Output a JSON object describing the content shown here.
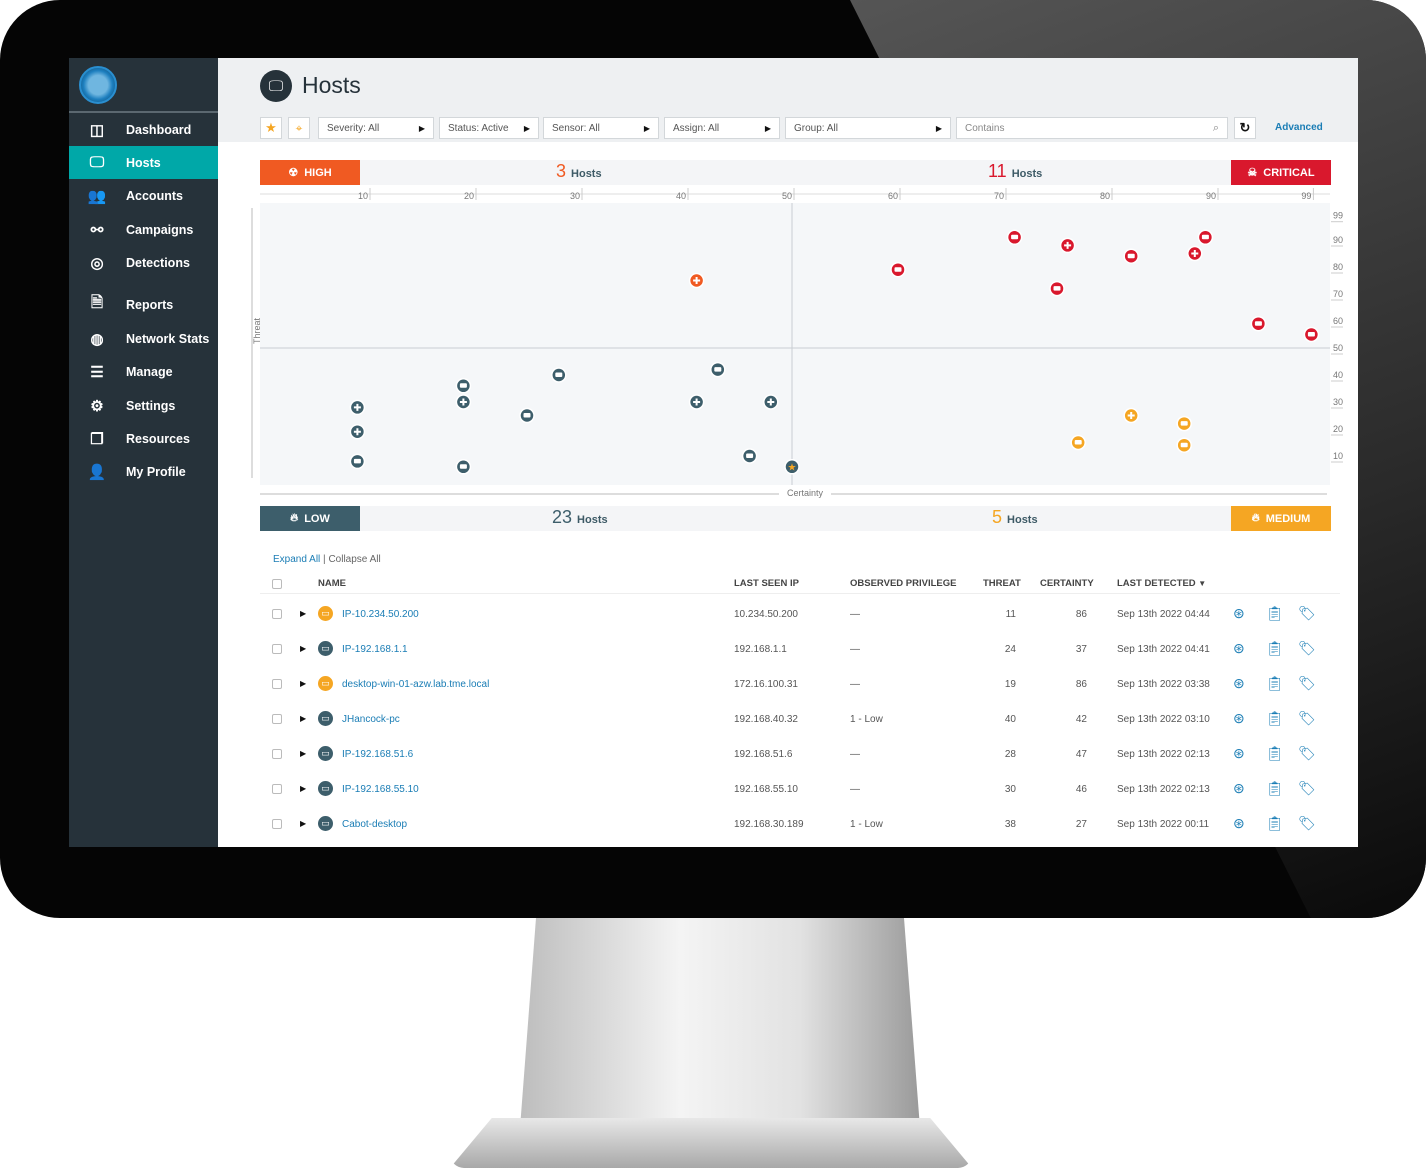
{
  "app": {
    "title": "Hosts"
  },
  "sidebar": {
    "items": [
      {
        "label": "Dashboard",
        "icon": "dashboard-icon",
        "glyph": "◫"
      },
      {
        "label": "Hosts",
        "icon": "monitor-icon",
        "glyph": "🖵",
        "active": true
      },
      {
        "label": "Accounts",
        "icon": "accounts-icon",
        "glyph": "👥"
      },
      {
        "label": "Campaigns",
        "icon": "campaigns-icon",
        "glyph": "⚯"
      },
      {
        "label": "Detections",
        "icon": "detections-icon",
        "glyph": "◎"
      },
      {
        "label": "Reports",
        "icon": "reports-icon",
        "glyph": "🗎"
      },
      {
        "label": "Network Stats",
        "icon": "network-stats-icon",
        "glyph": "◍"
      },
      {
        "label": "Manage",
        "icon": "manage-icon",
        "glyph": "☰"
      },
      {
        "label": "Settings",
        "icon": "gear-icon",
        "glyph": "⚙"
      },
      {
        "label": "Resources",
        "icon": "resources-icon",
        "glyph": "❐"
      },
      {
        "label": "My Profile",
        "icon": "profile-icon",
        "glyph": "👤"
      }
    ]
  },
  "filters": {
    "severity": "Severity: All",
    "status": "Status: Active",
    "sensor": "Sensor: All",
    "assign": "Assign: All",
    "group": "Group: All",
    "search_placeholder": "Contains",
    "advanced": "Advanced"
  },
  "quadrants": {
    "high": {
      "label": "HIGH",
      "count": "3",
      "color": "#f05a22"
    },
    "critical": {
      "label": "CRITICAL",
      "count": "11",
      "color": "#d9182d"
    },
    "low": {
      "label": "LOW",
      "count": "23",
      "color": "#3d5e6b"
    },
    "medium": {
      "label": "MEDIUM",
      "count": "5",
      "color": "#f5a623"
    },
    "hosts_word": "Hosts"
  },
  "chart_data": {
    "type": "scatter",
    "xlabel": "Certainty",
    "ylabel": "Threat",
    "xlim": [
      0,
      99
    ],
    "ylim": [
      0,
      99
    ],
    "xticks": [
      10,
      20,
      30,
      40,
      50,
      60,
      70,
      80,
      90,
      99
    ],
    "yticks": [
      99,
      90,
      80,
      70,
      60,
      50,
      40,
      30,
      20,
      10
    ],
    "series": [
      {
        "quadrant": "high",
        "color": "#f05a22",
        "points": [
          {
            "x": 41,
            "y": 75,
            "icon": "plus"
          }
        ]
      },
      {
        "quadrant": "critical",
        "color": "#d9182d",
        "points": [
          {
            "x": 60,
            "y": 79,
            "icon": "host"
          },
          {
            "x": 71,
            "y": 91,
            "icon": "host"
          },
          {
            "x": 76,
            "y": 88,
            "icon": "plus"
          },
          {
            "x": 75,
            "y": 72,
            "icon": "host"
          },
          {
            "x": 82,
            "y": 84,
            "icon": "host"
          },
          {
            "x": 88,
            "y": 85,
            "icon": "plus"
          },
          {
            "x": 89,
            "y": 91,
            "icon": "host"
          },
          {
            "x": 94,
            "y": 59,
            "icon": "host"
          },
          {
            "x": 99,
            "y": 55,
            "icon": "host"
          }
        ]
      },
      {
        "quadrant": "low",
        "color": "#3d5e6b",
        "points": [
          {
            "x": 9,
            "y": 28,
            "icon": "plus"
          },
          {
            "x": 9,
            "y": 19,
            "icon": "plus"
          },
          {
            "x": 9,
            "y": 8,
            "icon": "host"
          },
          {
            "x": 19,
            "y": 36,
            "icon": "host"
          },
          {
            "x": 19,
            "y": 30,
            "icon": "plus"
          },
          {
            "x": 19,
            "y": 6,
            "icon": "host"
          },
          {
            "x": 25,
            "y": 25,
            "icon": "host"
          },
          {
            "x": 28,
            "y": 40,
            "icon": "host"
          },
          {
            "x": 41,
            "y": 30,
            "icon": "plus"
          },
          {
            "x": 43,
            "y": 42,
            "icon": "host"
          },
          {
            "x": 48,
            "y": 30,
            "icon": "plus"
          },
          {
            "x": 46,
            "y": 10,
            "icon": "host"
          },
          {
            "x": 50,
            "y": 6,
            "icon": "star"
          }
        ]
      },
      {
        "quadrant": "medium",
        "color": "#f5a623",
        "points": [
          {
            "x": 77,
            "y": 15,
            "icon": "host"
          },
          {
            "x": 82,
            "y": 25,
            "icon": "plus"
          },
          {
            "x": 87,
            "y": 22,
            "icon": "host"
          },
          {
            "x": 87,
            "y": 14,
            "icon": "host"
          }
        ]
      }
    ]
  },
  "table": {
    "expand_all": "Expand All",
    "collapse_all": "Collapse All",
    "sep": "|",
    "headers": {
      "name": "NAME",
      "ip": "LAST SEEN IP",
      "privilege": "OBSERVED PRIVILEGE",
      "threat": "THREAT",
      "certainty": "CERTAINTY",
      "last_detected": "LAST DETECTED"
    },
    "rows": [
      {
        "name": "IP-10.234.50.200",
        "ip": "10.234.50.200",
        "privilege": "—",
        "threat": "11",
        "certainty": "86",
        "last_detected": "Sep 13th 2022 04:44",
        "color": "#f5a623"
      },
      {
        "name": "IP-192.168.1.1",
        "ip": "192.168.1.1",
        "privilege": "—",
        "threat": "24",
        "certainty": "37",
        "last_detected": "Sep 13th 2022 04:41",
        "color": "#3d5e6b"
      },
      {
        "name": "desktop-win-01-azw.lab.tme.local",
        "ip": "172.16.100.31",
        "privilege": "—",
        "threat": "19",
        "certainty": "86",
        "last_detected": "Sep 13th 2022 03:38",
        "color": "#f5a623"
      },
      {
        "name": "JHancock-pc",
        "ip": "192.168.40.32",
        "privilege": "1 - Low",
        "threat": "40",
        "certainty": "42",
        "last_detected": "Sep 13th 2022 03:10",
        "color": "#3d5e6b"
      },
      {
        "name": "IP-192.168.51.6",
        "ip": "192.168.51.6",
        "privilege": "—",
        "threat": "28",
        "certainty": "47",
        "last_detected": "Sep 13th 2022 02:13",
        "color": "#3d5e6b"
      },
      {
        "name": "IP-192.168.55.10",
        "ip": "192.168.55.10",
        "privilege": "—",
        "threat": "30",
        "certainty": "46",
        "last_detected": "Sep 13th 2022 02:13",
        "color": "#3d5e6b"
      },
      {
        "name": "Cabot-desktop",
        "ip": "192.168.30.189",
        "privilege": "1 - Low",
        "threat": "38",
        "certainty": "27",
        "last_detected": "Sep 13th 2022 00:11",
        "color": "#3d5e6b"
      }
    ]
  }
}
